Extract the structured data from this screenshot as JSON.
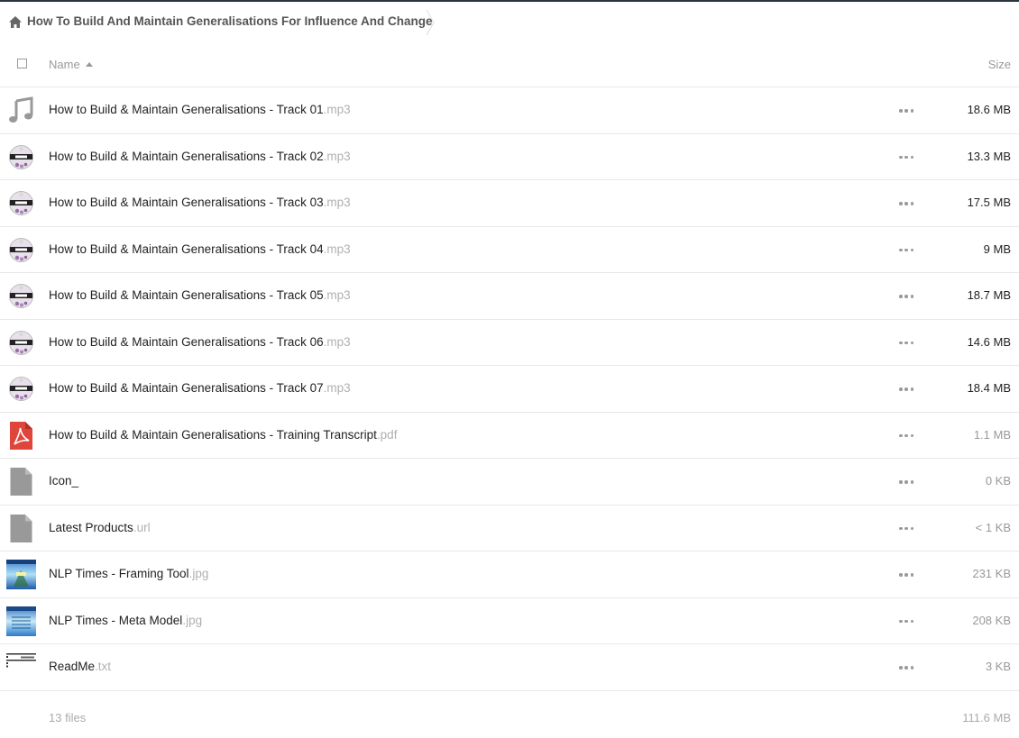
{
  "breadcrumb": {
    "home_icon": "home-icon",
    "folder": "How To Build And Maintain Generalisations For Influence And Change"
  },
  "header": {
    "name_label": "Name",
    "size_label": "Size"
  },
  "files": [
    {
      "name": "How to Build & Maintain Generalisations - Track 01",
      "ext": ".mp3",
      "size": "18.6 MB",
      "icon": "music-note-icon",
      "size_muted": false
    },
    {
      "name": "How to Build & Maintain Generalisations - Track 02",
      "ext": ".mp3",
      "size": "13.3 MB",
      "icon": "album-thumbnail",
      "size_muted": false
    },
    {
      "name": "How to Build & Maintain Generalisations - Track 03",
      "ext": ".mp3",
      "size": "17.5 MB",
      "icon": "album-thumbnail",
      "size_muted": false
    },
    {
      "name": "How to Build & Maintain Generalisations - Track 04",
      "ext": ".mp3",
      "size": "9 MB",
      "icon": "album-thumbnail",
      "size_muted": false
    },
    {
      "name": "How to Build & Maintain Generalisations - Track 05",
      "ext": ".mp3",
      "size": "18.7 MB",
      "icon": "album-thumbnail",
      "size_muted": false
    },
    {
      "name": "How to Build & Maintain Generalisations - Track 06",
      "ext": ".mp3",
      "size": "14.6 MB",
      "icon": "album-thumbnail",
      "size_muted": false
    },
    {
      "name": "How to Build & Maintain Generalisations - Track 07",
      "ext": ".mp3",
      "size": "18.4 MB",
      "icon": "album-thumbnail",
      "size_muted": false
    },
    {
      "name": "How to Build & Maintain Generalisations - Training Transcript",
      "ext": ".pdf",
      "size": "1.1 MB",
      "icon": "pdf-icon",
      "size_muted": true
    },
    {
      "name": "Icon_",
      "ext": "",
      "size": "0 KB",
      "icon": "file-icon",
      "size_muted": true
    },
    {
      "name": "Latest Products",
      "ext": ".url",
      "size": "< 1 KB",
      "icon": "file-icon",
      "size_muted": true
    },
    {
      "name": "NLP Times - Framing Tool",
      "ext": ".jpg",
      "size": "231 KB",
      "icon": "image-thumbnail-framing",
      "size_muted": true
    },
    {
      "name": "NLP Times - Meta Model",
      "ext": ".jpg",
      "size": "208 KB",
      "icon": "image-thumbnail-meta",
      "size_muted": true
    },
    {
      "name": "ReadMe",
      "ext": ".txt",
      "size": "3 KB",
      "icon": "text-thumbnail",
      "size_muted": true
    }
  ],
  "footer": {
    "count": "13 files",
    "total": "111.6 MB"
  },
  "colors": {
    "topline": "#2a3540",
    "pdf_red": "#e0453c",
    "icon_gray": "#999999"
  }
}
